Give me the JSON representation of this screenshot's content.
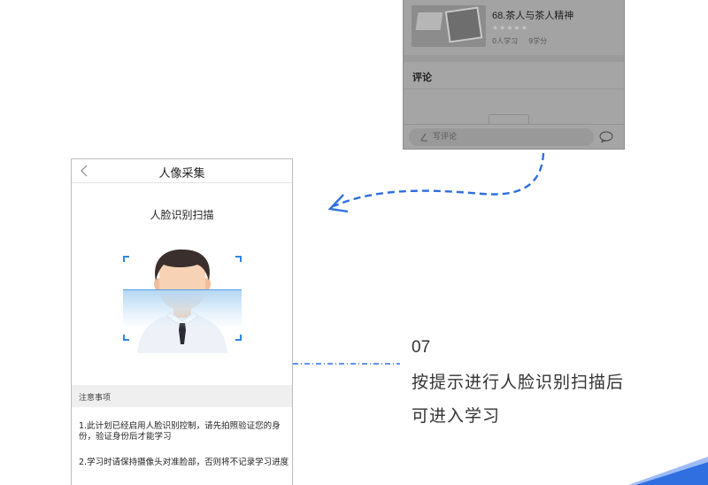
{
  "top_phone": {
    "course": {
      "title": "68.茶人与茶人精神",
      "stars": "★★★★★",
      "learners": "0人学习",
      "credits": "9学分"
    },
    "comments_title": "评论",
    "comment_input_placeholder": "写评论"
  },
  "main_phone": {
    "nav_title": "人像采集",
    "scan_title": "人脸识别扫描",
    "notice_label": "注意事项",
    "notices": [
      "1.此计划已经启用人脸识别控制，请先拍照验证您的身份，验证身份后才能学习",
      "2.学习时请保持摄像头对准脸部，否则将不记录学习进度"
    ]
  },
  "caption": {
    "step_number": "07",
    "line1": "按提示进行人脸识别扫描后",
    "line2": "可进入学习"
  },
  "colors": {
    "accent_blue": "#2f6fe0",
    "scan_blue": "#2f86e0",
    "overlay_grey": "#a5a5a5"
  }
}
